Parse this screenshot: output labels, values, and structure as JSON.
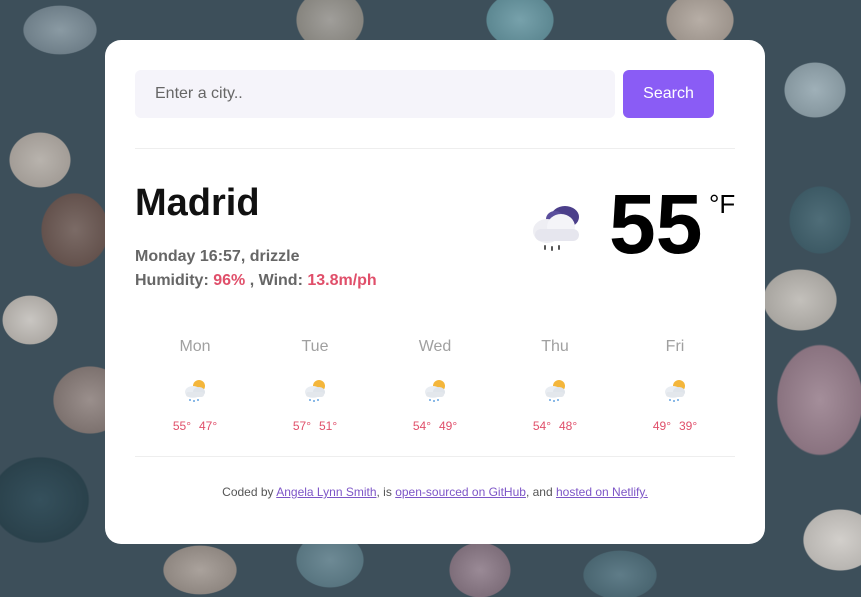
{
  "search": {
    "placeholder": "Enter a city..",
    "button_label": "Search"
  },
  "current": {
    "city": "Madrid",
    "datetime_condition": "Monday 16:57, drizzle",
    "humidity_label": "Humidity:",
    "humidity_value": "96%",
    "wind_label": ", Wind:",
    "wind_value": "13.8m/ph",
    "temperature": "55",
    "unit": "°F",
    "icon": "rain-cloud-icon"
  },
  "forecast": [
    {
      "day": "Mon",
      "high": "55°",
      "low": "47°",
      "icon": "sun-cloud-rain-icon"
    },
    {
      "day": "Tue",
      "high": "57°",
      "low": "51°",
      "icon": "sun-cloud-rain-icon"
    },
    {
      "day": "Wed",
      "high": "54°",
      "low": "49°",
      "icon": "sun-cloud-rain-icon"
    },
    {
      "day": "Thu",
      "high": "54°",
      "low": "48°",
      "icon": "sun-cloud-rain-icon"
    },
    {
      "day": "Fri",
      "high": "49°",
      "low": "39°",
      "icon": "sun-cloud-rain-icon"
    }
  ],
  "footer": {
    "prefix": "Coded by",
    "author": "Angela Lynn Smith",
    "sep1": ", is",
    "github": "open-sourced on GitHub",
    "sep2": ", and",
    "netlify": "hosted on Netlify."
  },
  "colors": {
    "accent": "#8a5cf5",
    "highlight": "#e04f6a",
    "link": "#7d55c7"
  }
}
